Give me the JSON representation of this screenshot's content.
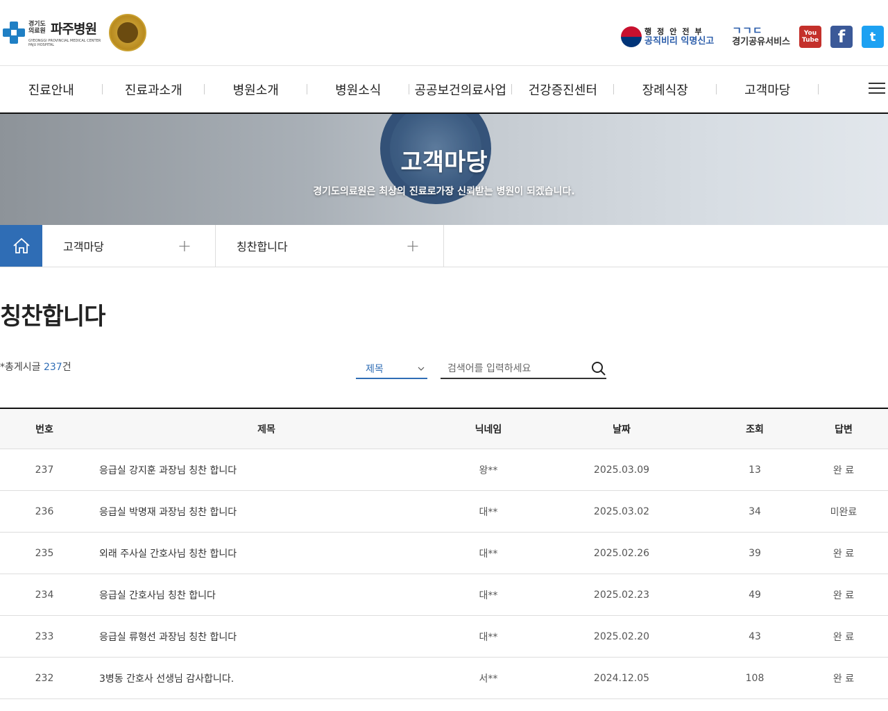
{
  "header": {
    "logo_org": "경기도 의료원",
    "logo_name": "파주병원",
    "logo_en": "GYEONGGI PROVINCIAL MEDICAL CENTER PAJU HOSPITAL",
    "gov_top": "행정안전부",
    "gov_link": "공직비리 익명신고",
    "share_logo": "ㄱㄱㄷ",
    "share_text": "경기공유서비스",
    "youtube": "You Tube",
    "facebook": "f",
    "twitter": "t"
  },
  "gnb": [
    "진료안내",
    "진료과소개",
    "병원소개",
    "병원소식",
    "공공보건의료사업",
    "건강증진센터",
    "장례식장",
    "고객마당"
  ],
  "banner": {
    "title": "고객마당",
    "subtitle": "경기도의료원은 최상의 진료로가장 신뢰받는 병원이 되겠습니다."
  },
  "location": {
    "depth1": "고객마당",
    "depth2": "칭찬합니다"
  },
  "page": {
    "title": "칭찬합니다",
    "total_prefix": "*총게시글 ",
    "total_count": "237",
    "total_suffix": "건"
  },
  "search": {
    "select_value": "제목",
    "placeholder": "검색어를 입력하세요"
  },
  "table": {
    "headers": [
      "번호",
      "제목",
      "닉네임",
      "날짜",
      "조회",
      "답변"
    ],
    "rows": [
      {
        "no": "237",
        "title": "응급실 강지훈 과장님 칭찬 합니다",
        "nick": "왕**",
        "date": "2025.03.09",
        "views": "13",
        "answer": "완 료"
      },
      {
        "no": "236",
        "title": "응급실 박명재 과장님 칭찬 합니다",
        "nick": "대**",
        "date": "2025.03.02",
        "views": "34",
        "answer": "미완료"
      },
      {
        "no": "235",
        "title": "외래 주사실 간호사님 칭찬 합니다",
        "nick": "대**",
        "date": "2025.02.26",
        "views": "39",
        "answer": "완 료"
      },
      {
        "no": "234",
        "title": "응급실 간호사님 칭찬 합니다",
        "nick": "대**",
        "date": "2025.02.23",
        "views": "49",
        "answer": "완 료"
      },
      {
        "no": "233",
        "title": "응급실 류형선 과장님 칭찬 합니다",
        "nick": "대**",
        "date": "2025.02.20",
        "views": "43",
        "answer": "완 료"
      },
      {
        "no": "232",
        "title": "3병동 간호사 선생님 감사합니다.",
        "nick": "서**",
        "date": "2024.12.05",
        "views": "108",
        "answer": "완 료"
      }
    ]
  }
}
